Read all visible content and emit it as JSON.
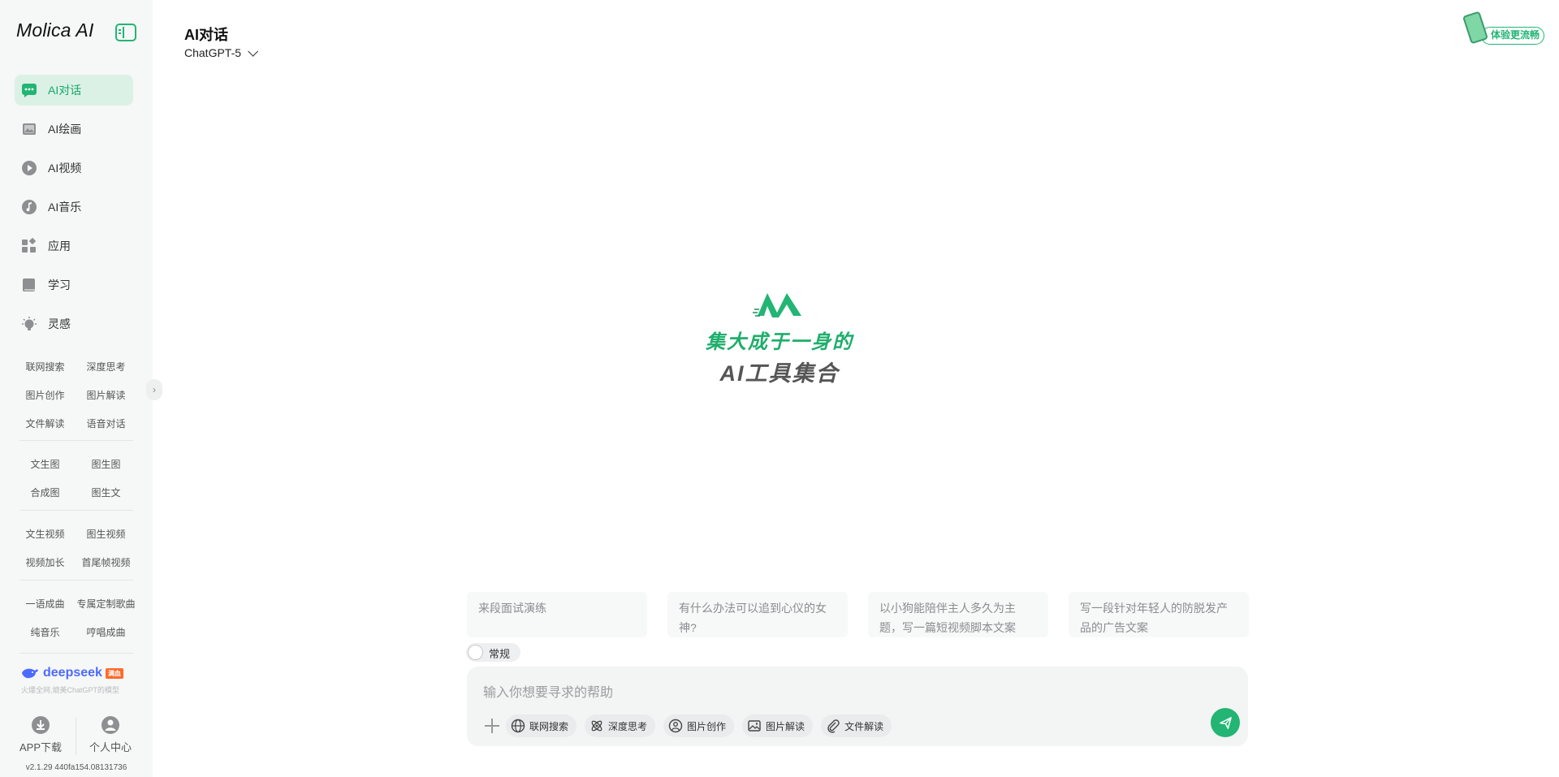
{
  "app": {
    "logo": "Molica AI",
    "version": "v2.1.29 440fa154.08131736"
  },
  "colors": {
    "accent": "#22b573",
    "active_bg": "#dbf1e6",
    "sidebar_bg": "#f6f7f7"
  },
  "sidebar": {
    "nav": [
      {
        "label": "AI对话",
        "icon": "chat-icon",
        "active": true
      },
      {
        "label": "AI绘画",
        "icon": "image-icon",
        "active": false
      },
      {
        "label": "AI视频",
        "icon": "play-icon",
        "active": false
      },
      {
        "label": "AI音乐",
        "icon": "music-icon",
        "active": false
      },
      {
        "label": "应用",
        "icon": "apps-icon",
        "active": false
      },
      {
        "label": "学习",
        "icon": "book-icon",
        "active": false
      },
      {
        "label": "灵感",
        "icon": "lightbulb-icon",
        "active": false
      }
    ],
    "shortcut_groups": [
      [
        [
          "联网搜索",
          "深度思考"
        ],
        [
          "图片创作",
          "图片解读"
        ],
        [
          "文件解读",
          "语音对话"
        ]
      ],
      [
        [
          "文生图",
          "图生图"
        ],
        [
          "合成图",
          "图生文"
        ]
      ],
      [
        [
          "文生视频",
          "图生视频"
        ],
        [
          "视频加长",
          "首尾帧视频"
        ]
      ],
      [
        [
          "一语成曲",
          "专属定制歌曲"
        ],
        [
          "纯音乐",
          "哼唱成曲"
        ]
      ]
    ],
    "deepseek": {
      "name": "deepseek",
      "badge": "满血",
      "subtitle": "火爆全网,媲美ChatGPT的模型"
    },
    "bottom": {
      "app_download": "APP下载",
      "personal_center": "个人中心"
    }
  },
  "header": {
    "title": "AI对话",
    "model": "ChatGPT-5",
    "promo": "体验更流畅"
  },
  "brand": {
    "slogan_line1": "集大成于一身的",
    "slogan_line2": "AI工具集合"
  },
  "suggestions": [
    "来段面试演练",
    "有什么办法可以追到心仪的女神?",
    "以小狗能陪伴主人多久为主题，写一篇短视频脚本文案",
    "写一段针对年轻人的防脱发产品的广告文案"
  ],
  "mode_toggle": {
    "label": "常规",
    "on": false
  },
  "composer": {
    "placeholder": "输入你想要寻求的帮助",
    "tools": [
      {
        "label": "联网搜索",
        "icon": "globe-icon"
      },
      {
        "label": "深度思考",
        "icon": "atom-icon"
      },
      {
        "label": "图片创作",
        "icon": "palette-icon"
      },
      {
        "label": "图片解读",
        "icon": "picture-icon"
      },
      {
        "label": "文件解读",
        "icon": "paperclip-icon"
      }
    ]
  }
}
